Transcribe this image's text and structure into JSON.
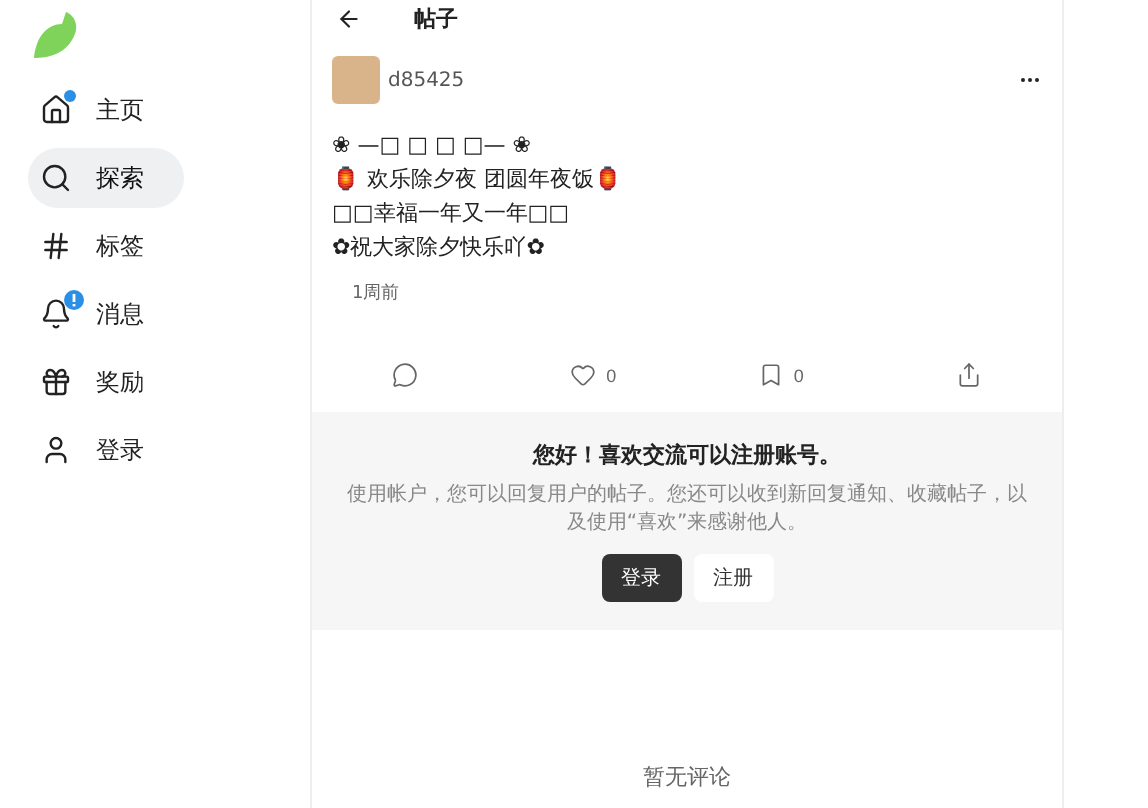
{
  "sidebar": {
    "items": [
      {
        "label": "主页",
        "kind": "dot",
        "selected": false
      },
      {
        "label": "探索",
        "kind": "plain",
        "selected": true
      },
      {
        "label": "标签",
        "kind": "plain",
        "selected": false
      },
      {
        "label": "消息",
        "kind": "alert",
        "selected": false
      },
      {
        "label": "奖励",
        "kind": "plain",
        "selected": false
      },
      {
        "label": "登录",
        "kind": "plain",
        "selected": false
      }
    ]
  },
  "header": {
    "title": "帖子"
  },
  "post": {
    "author": "d85425",
    "lines": [
      "❀ —□ □ □ □— ❀",
      "🏮 欢乐除夕夜 团圆年夜饭🏮",
      "□□幸福一年又一年□□",
      "✿祝大家除夕快乐吖✿"
    ],
    "time": "1周前",
    "like_count": "0",
    "bookmark_count": "0"
  },
  "prompt": {
    "title": "您好！喜欢交流可以注册账号。",
    "text": "使用帐户，您可以回复用户的帖子。您还可以收到新回复通知、收藏帖子，以及使用“喜欢”来感谢他人。",
    "buttons": [
      {
        "label": "登录",
        "kind": "primary"
      },
      {
        "label": "注册",
        "kind": "secondary"
      }
    ]
  },
  "comments": {
    "empty": "暂无评论"
  }
}
